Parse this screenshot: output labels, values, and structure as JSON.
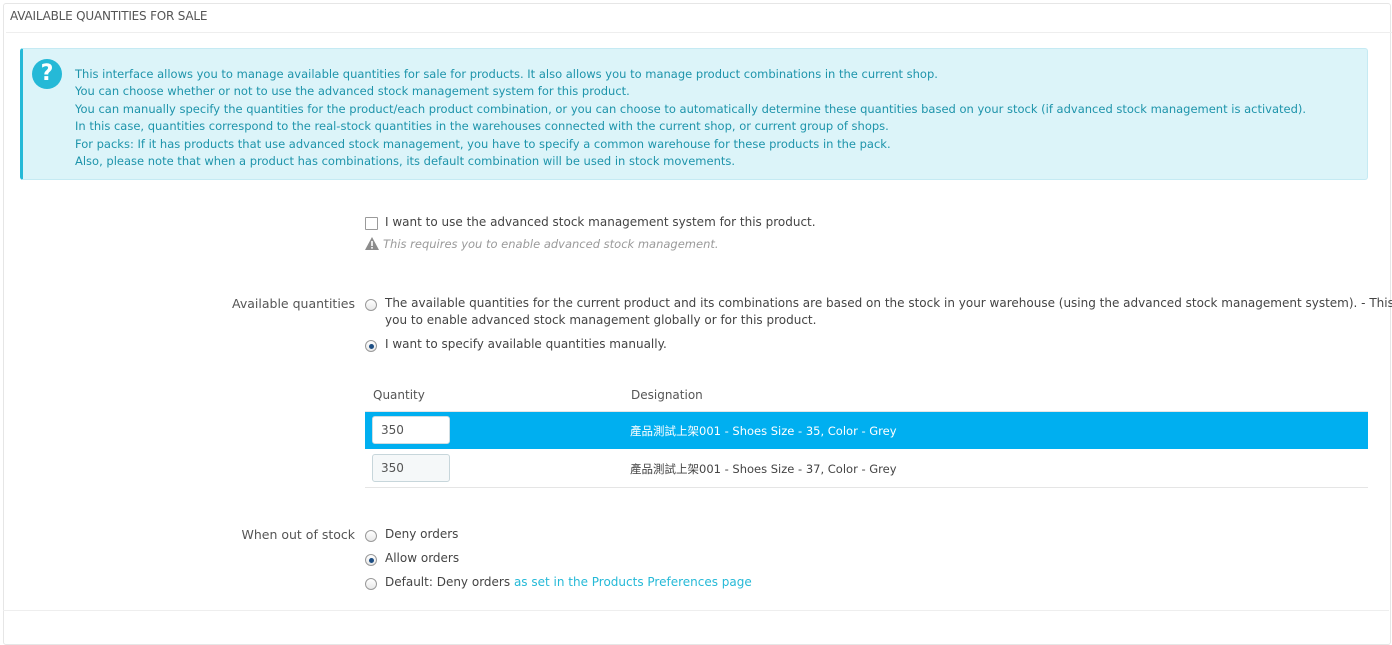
{
  "panel": {
    "heading": "AVAILABLE QUANTITIES FOR SALE"
  },
  "info": {
    "icon": "question-icon",
    "lines": [
      "This interface allows you to manage available quantities for sale for products. It also allows you to manage product combinations in the current shop.",
      "You can choose whether or not to use the advanced stock management system for this product.",
      "You can manually specify the quantities for the product/each product combination, or you can choose to automatically determine these quantities based on your stock (if advanced stock management is activated).",
      "In this case, quantities correspond to the real-stock quantities in the warehouses connected with the current shop, or current group of shops.",
      "For packs: If it has products that use advanced stock management, you have to specify a common warehouse for these products in the pack.",
      "Also, please note that when a product has combinations, its default combination will be used in stock movements."
    ]
  },
  "advanced": {
    "checkbox_label": "I want to use the advanced stock management system for this product.",
    "checked": false,
    "help": "This requires you to enable advanced stock management."
  },
  "available": {
    "label": "Available quantities",
    "option_warehouse_line1": "The available quantities for the current product and its combinations are based on the stock in your warehouse (using the advanced stock management system).  - This requires",
    "option_warehouse_line2": "you to enable advanced stock management globally or for this product.",
    "option_manual": "I want to specify available quantities manually.",
    "selected": "manual"
  },
  "table": {
    "headers": {
      "quantity": "Quantity",
      "designation": "Designation"
    },
    "rows": [
      {
        "quantity": "350",
        "designation": "產品測試上架001 - Shoes Size - 35, Color - Grey",
        "highlighted": true
      },
      {
        "quantity": "350",
        "designation": "產品測試上架001 - Shoes Size - 37, Color - Grey",
        "highlighted": false
      }
    ]
  },
  "out_of_stock": {
    "label": "When out of stock",
    "options": {
      "deny": "Deny orders",
      "allow": "Allow orders",
      "default_prefix": "Default: Deny orders",
      "default_link": "as set in the Products Preferences page"
    },
    "selected": "allow"
  },
  "colors": {
    "info_text": "#1e94ab",
    "info_bg": "#dcf4f9",
    "accent": "#25b9d7",
    "row_highlight": "#00aff0"
  }
}
